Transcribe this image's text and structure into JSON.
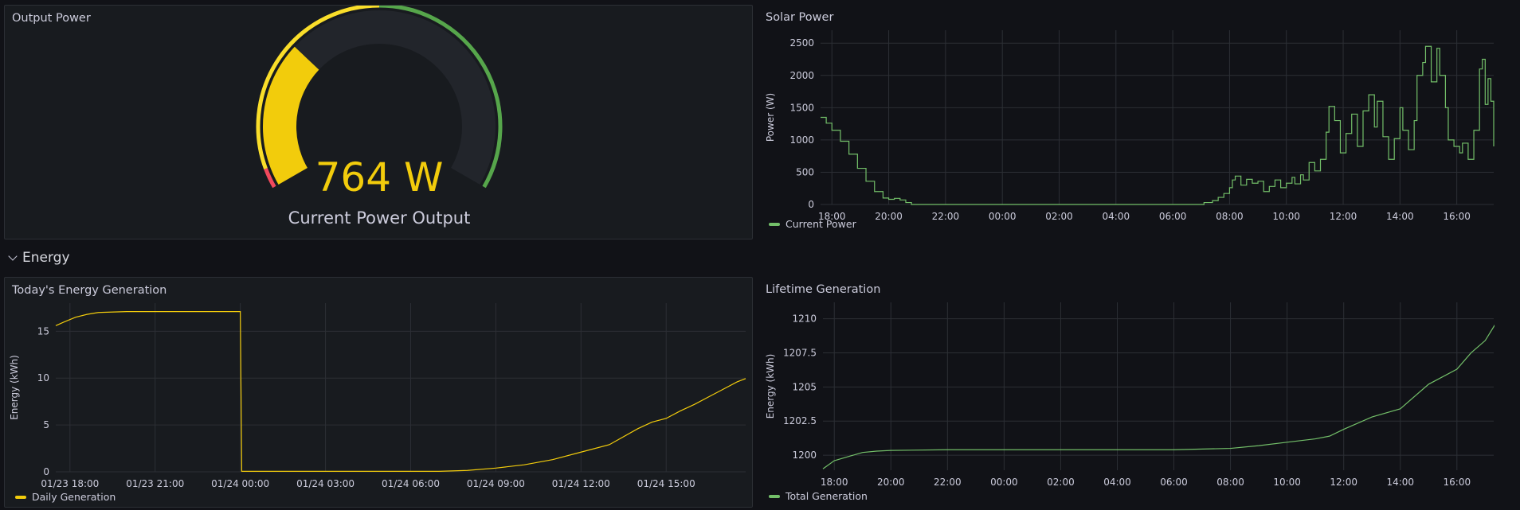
{
  "panels": {
    "output_power": {
      "title": "Output Power",
      "value": 764,
      "unit": "W",
      "display_value": "764 W",
      "label": "Current Power Output",
      "gauge_max": 2500,
      "thresholds": [
        {
          "from": 0,
          "color": "#f2495c"
        },
        {
          "from": 100,
          "color": "#fade2a"
        },
        {
          "from": 1250,
          "color": "#56a64b"
        }
      ],
      "value_color": "#f2cc0c"
    },
    "solar_power": {
      "title": "Solar Power",
      "legend": "Current Power",
      "color": "#73bf69"
    },
    "energy_row": {
      "title": "Energy"
    },
    "todays_energy": {
      "title": "Today's Energy Generation",
      "legend": "Daily Generation",
      "color": "#f2cc0c"
    },
    "lifetime": {
      "title": "Lifetime Generation",
      "legend": "Total Generation",
      "color": "#73bf69"
    }
  },
  "chart_data": [
    {
      "type": "line",
      "panel": "solar_power",
      "ylabel": "Power (W)",
      "x_ticks": [
        "18:00",
        "20:00",
        "22:00",
        "00:00",
        "02:00",
        "04:00",
        "06:00",
        "08:00",
        "10:00",
        "12:00",
        "14:00",
        "16:00"
      ],
      "x_range_hours": [
        17.6,
        41.3
      ],
      "ylim": [
        0,
        2700
      ],
      "y_ticks": [
        0,
        500,
        1000,
        1500,
        2000,
        2500
      ],
      "series": [
        {
          "name": "Current Power",
          "points": [
            [
              17.6,
              1350
            ],
            [
              17.8,
              1260
            ],
            [
              18.0,
              1150
            ],
            [
              18.3,
              980
            ],
            [
              18.6,
              780
            ],
            [
              18.9,
              560
            ],
            [
              19.2,
              360
            ],
            [
              19.5,
              200
            ],
            [
              19.8,
              100
            ],
            [
              20.0,
              80
            ],
            [
              20.2,
              95
            ],
            [
              20.4,
              70
            ],
            [
              20.6,
              30
            ],
            [
              20.8,
              0
            ],
            [
              30.9,
              0
            ],
            [
              31.1,
              30
            ],
            [
              31.4,
              60
            ],
            [
              31.6,
              110
            ],
            [
              31.8,
              170
            ],
            [
              32.0,
              260
            ],
            [
              32.1,
              380
            ],
            [
              32.2,
              440
            ],
            [
              32.4,
              300
            ],
            [
              32.6,
              390
            ],
            [
              32.8,
              330
            ],
            [
              33.0,
              360
            ],
            [
              33.2,
              200
            ],
            [
              33.4,
              280
            ],
            [
              33.6,
              380
            ],
            [
              33.8,
              260
            ],
            [
              34.0,
              330
            ],
            [
              34.2,
              420
            ],
            [
              34.3,
              320
            ],
            [
              34.5,
              460
            ],
            [
              34.6,
              380
            ],
            [
              34.8,
              650
            ],
            [
              35.0,
              520
            ],
            [
              35.2,
              700
            ],
            [
              35.4,
              1120
            ],
            [
              35.5,
              1520
            ],
            [
              35.7,
              1300
            ],
            [
              35.9,
              800
            ],
            [
              36.1,
              1100
            ],
            [
              36.3,
              1400
            ],
            [
              36.5,
              900
            ],
            [
              36.7,
              1450
            ],
            [
              36.9,
              1700
            ],
            [
              37.1,
              1200
            ],
            [
              37.2,
              1600
            ],
            [
              37.4,
              1050
            ],
            [
              37.6,
              700
            ],
            [
              37.8,
              1020
            ],
            [
              38.0,
              1500
            ],
            [
              38.1,
              1150
            ],
            [
              38.3,
              850
            ],
            [
              38.5,
              1300
            ],
            [
              38.6,
              2000
            ],
            [
              38.8,
              2200
            ],
            [
              38.9,
              2450
            ],
            [
              39.1,
              1900
            ],
            [
              39.3,
              2420
            ],
            [
              39.4,
              2000
            ],
            [
              39.6,
              1500
            ],
            [
              39.7,
              1000
            ],
            [
              39.9,
              900
            ],
            [
              40.1,
              800
            ],
            [
              40.2,
              950
            ],
            [
              40.4,
              700
            ],
            [
              40.6,
              1150
            ],
            [
              40.8,
              2100
            ],
            [
              40.9,
              2250
            ],
            [
              41.0,
              1550
            ],
            [
              41.1,
              1950
            ],
            [
              41.2,
              1600
            ],
            [
              41.3,
              900
            ]
          ]
        }
      ]
    },
    {
      "type": "line",
      "panel": "todays_energy",
      "ylabel": "Energy (kWh)",
      "x_ticks": [
        "01/23 18:00",
        "01/23 21:00",
        "01/24 00:00",
        "01/24 03:00",
        "01/24 06:00",
        "01/24 09:00",
        "01/24 12:00",
        "01/24 15:00"
      ],
      "x_range_hours": [
        17.5,
        41.8
      ],
      "ylim": [
        0,
        18
      ],
      "y_ticks": [
        0,
        5,
        10,
        15
      ],
      "series": [
        {
          "name": "Daily Generation",
          "points": [
            [
              17.5,
              15.6
            ],
            [
              17.8,
              16.0
            ],
            [
              18.2,
              16.5
            ],
            [
              18.6,
              16.8
            ],
            [
              19.0,
              17.0
            ],
            [
              20.0,
              17.1
            ],
            [
              22.0,
              17.1
            ],
            [
              24.0,
              17.1
            ],
            [
              24.05,
              0.05
            ],
            [
              31.0,
              0.05
            ],
            [
              32.0,
              0.15
            ],
            [
              33.0,
              0.4
            ],
            [
              34.0,
              0.75
            ],
            [
              35.0,
              1.3
            ],
            [
              36.0,
              2.1
            ],
            [
              37.0,
              2.9
            ],
            [
              38.0,
              4.6
            ],
            [
              38.5,
              5.3
            ],
            [
              39.0,
              5.7
            ],
            [
              39.5,
              6.5
            ],
            [
              40.0,
              7.2
            ],
            [
              40.5,
              8.0
            ],
            [
              41.0,
              8.8
            ],
            [
              41.5,
              9.6
            ],
            [
              41.8,
              9.95
            ]
          ]
        }
      ]
    },
    {
      "type": "line",
      "panel": "lifetime",
      "ylabel": "Energy (kWh)",
      "x_ticks": [
        "18:00",
        "20:00",
        "22:00",
        "00:00",
        "02:00",
        "04:00",
        "06:00",
        "08:00",
        "10:00",
        "12:00",
        "14:00",
        "16:00"
      ],
      "x_range_hours": [
        17.6,
        41.3
      ],
      "ylim": [
        1198.9,
        1211.2
      ],
      "y_ticks": [
        1200,
        1202.5,
        1205,
        1207.5,
        1210
      ],
      "y_tick_labels": [
        "1200",
        "1202.5",
        "1205",
        "1207.5",
        "1210"
      ],
      "series": [
        {
          "name": "Total Generation",
          "points": [
            [
              17.6,
              1199.0
            ],
            [
              18.0,
              1199.6
            ],
            [
              18.5,
              1199.9
            ],
            [
              19.0,
              1200.2
            ],
            [
              19.5,
              1200.3
            ],
            [
              20.0,
              1200.35
            ],
            [
              22.0,
              1200.4
            ],
            [
              26.0,
              1200.4
            ],
            [
              30.0,
              1200.4
            ],
            [
              32.0,
              1200.5
            ],
            [
              33.0,
              1200.7
            ],
            [
              34.0,
              1200.95
            ],
            [
              35.0,
              1201.2
            ],
            [
              35.5,
              1201.4
            ],
            [
              36.0,
              1201.9
            ],
            [
              37.0,
              1202.8
            ],
            [
              38.0,
              1203.4
            ],
            [
              39.0,
              1205.2
            ],
            [
              40.0,
              1206.3
            ],
            [
              40.5,
              1207.5
            ],
            [
              41.0,
              1208.4
            ],
            [
              41.5,
              1209.6
            ],
            [
              42.0,
              1210.3
            ],
            [
              42.5,
              1210.8
            ],
            [
              42.8,
              1211.0
            ]
          ]
        }
      ]
    }
  ]
}
